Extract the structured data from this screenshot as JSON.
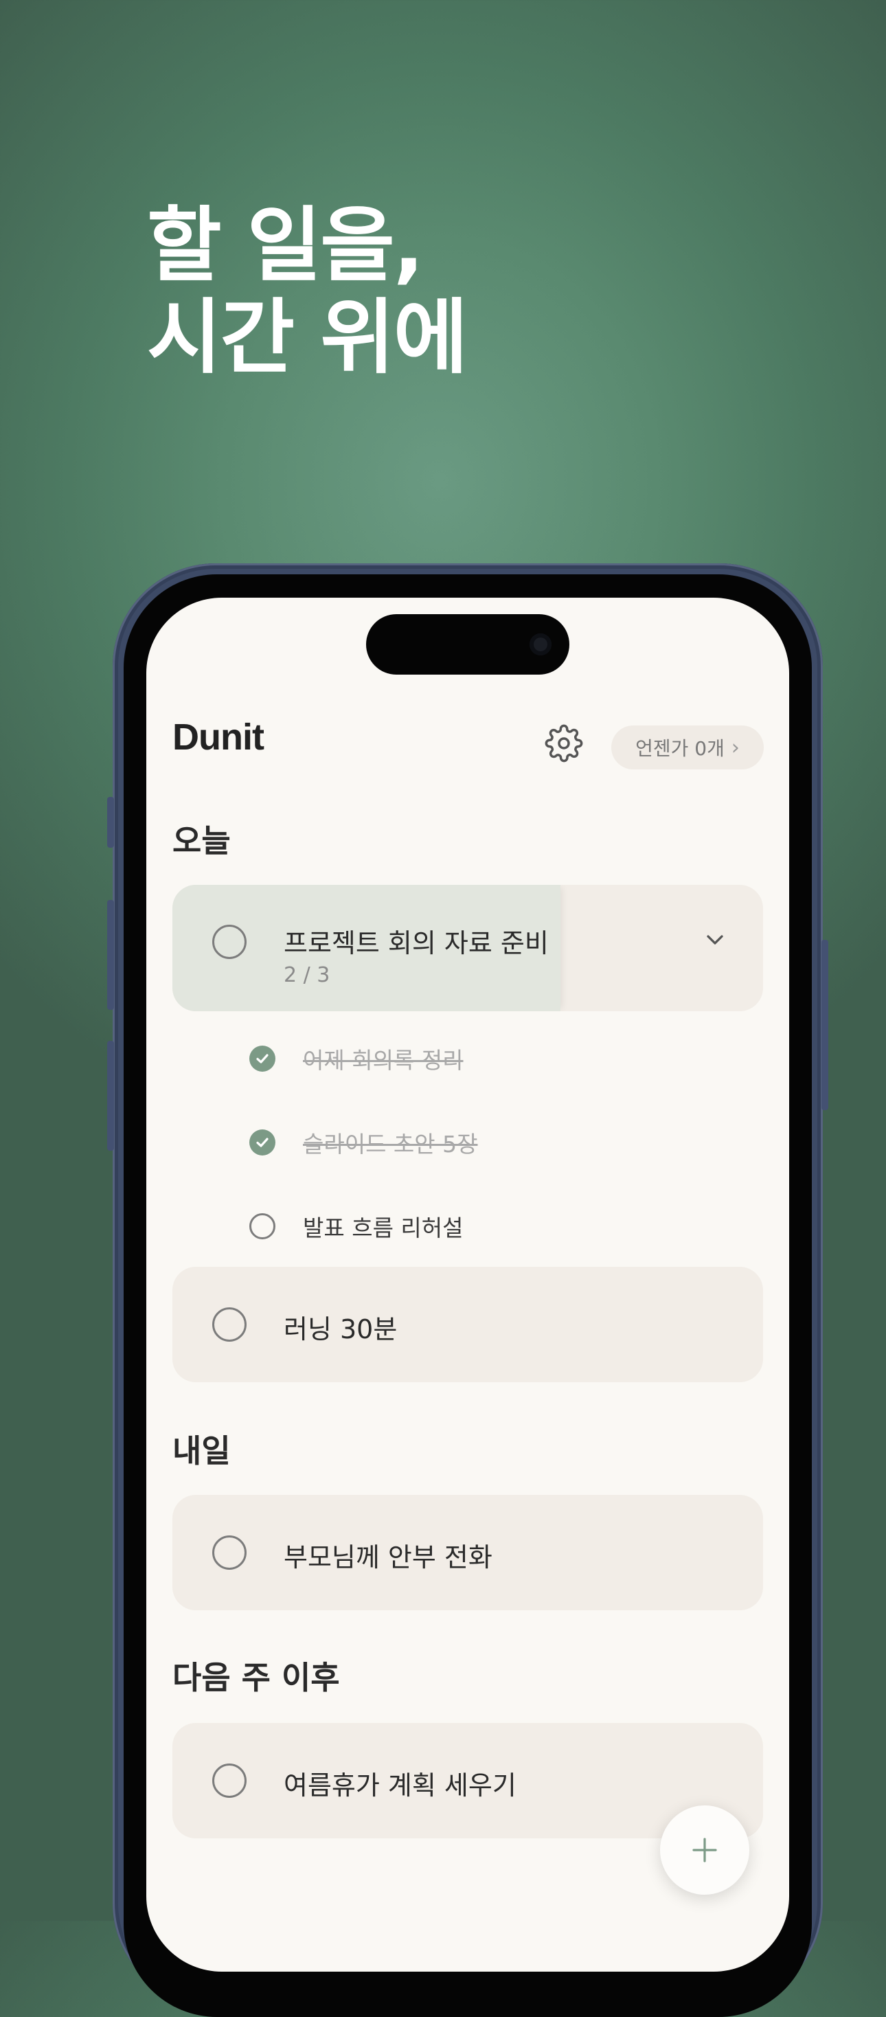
{
  "promo": {
    "headline_line1": "할 일을,",
    "headline_line2": "시간 위에"
  },
  "app": {
    "title": "Dunit",
    "settings_icon": "gear-icon",
    "someday_label": "언젠가 0개",
    "someday_chevron": "›"
  },
  "sections": {
    "today": "오늘",
    "tomorrow": "내일",
    "later": "다음 주 이후"
  },
  "tasks": {
    "project": {
      "label": "프로젝트 회의 자료 준비",
      "progress": "2 / 3",
      "subtasks": [
        {
          "label": "어제 회의록 정리",
          "done": true
        },
        {
          "label": "슬라이드 초안 5장",
          "done": true
        },
        {
          "label": "발표 흐름 리허설",
          "done": false
        }
      ]
    },
    "running": {
      "label": "러닝 30분"
    },
    "call": {
      "label": "부모님께 안부 전화"
    },
    "vacation": {
      "label": "여름휴가 계획 세우기"
    }
  },
  "colors": {
    "background": "#5a8a70",
    "screen": "#faf8f4",
    "card": "#f2ede7",
    "swipe_highlight": "#e2e6de",
    "check_green": "#7c9a86"
  },
  "fab": {
    "icon": "plus-icon"
  }
}
